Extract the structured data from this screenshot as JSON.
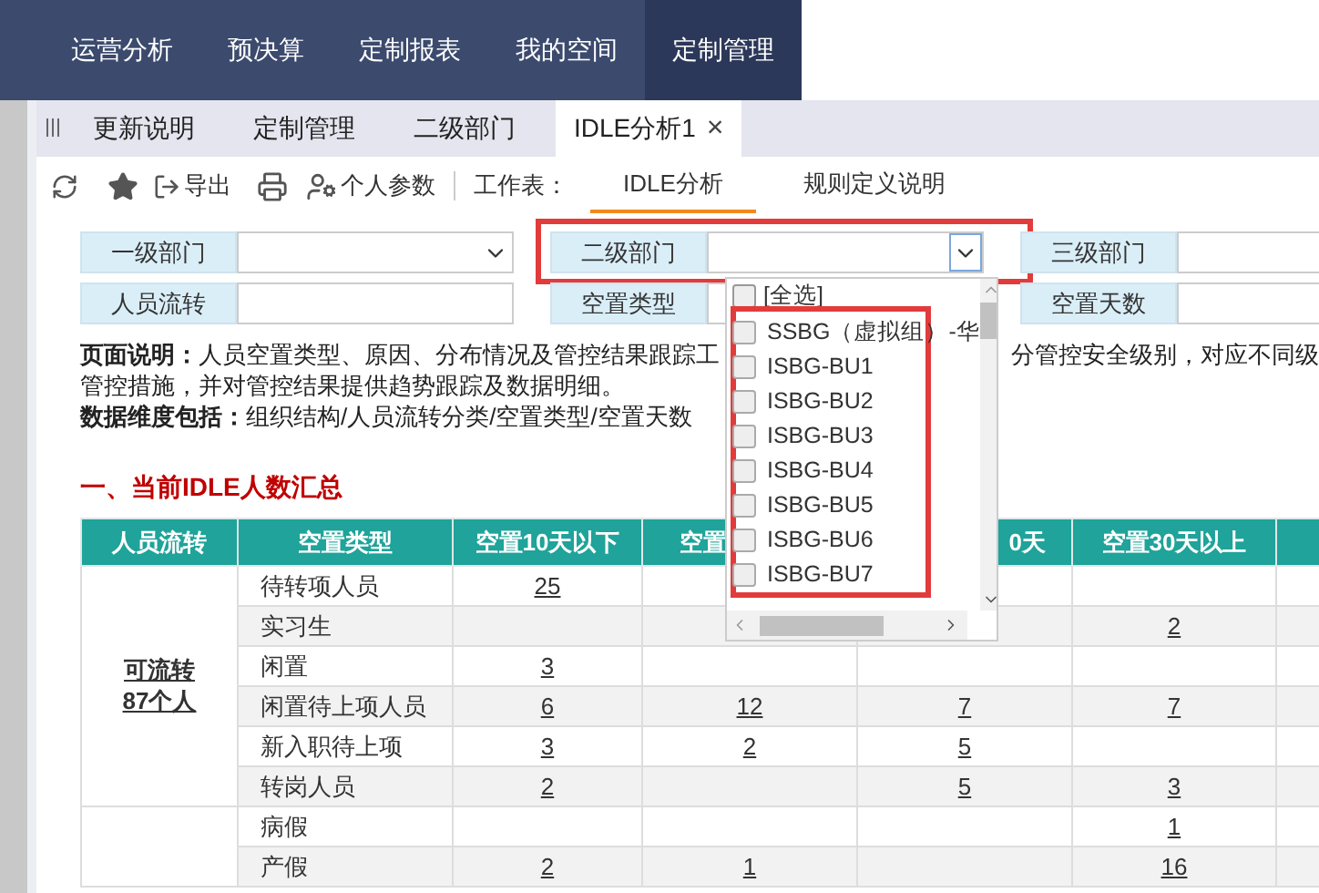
{
  "nav": {
    "items": [
      {
        "label": "运营分析",
        "selected": false
      },
      {
        "label": "预决算",
        "selected": false
      },
      {
        "label": "定制报表",
        "selected": false
      },
      {
        "label": "我的空间",
        "selected": false
      },
      {
        "label": "定制管理",
        "selected": true
      }
    ]
  },
  "tabs": [
    {
      "label": "更新说明",
      "selected": false
    },
    {
      "label": "定制管理",
      "selected": false
    },
    {
      "label": "二级部门",
      "selected": false
    },
    {
      "label": "IDLE分析1",
      "selected": true,
      "close": "×"
    }
  ],
  "toolbar": {
    "export": "导出",
    "personal": "个人参数",
    "sheet_label": "工作表：",
    "sheets": [
      {
        "label": "IDLE分析",
        "selected": true
      },
      {
        "label": "规则定义说明",
        "selected": false
      }
    ]
  },
  "filters": [
    {
      "label": "一级部门",
      "kind": "select"
    },
    {
      "label": "二级部门",
      "kind": "select",
      "focused": true,
      "highlighted": true
    },
    {
      "label": "三级部门",
      "kind": "field"
    },
    {
      "label": "人员流转",
      "kind": "field"
    },
    {
      "label": "空置类型",
      "kind": "field"
    },
    {
      "label": "空置天数",
      "kind": "field"
    }
  ],
  "dropdown": {
    "select_all": {
      "label": "[全选]",
      "checked": false
    },
    "options_highlighted": true,
    "options": [
      {
        "label": "SSBG（虚拟组）-华",
        "checked": false
      },
      {
        "label": "ISBG-BU1",
        "checked": false
      },
      {
        "label": "ISBG-BU2",
        "checked": false
      },
      {
        "label": "ISBG-BU3",
        "checked": false
      },
      {
        "label": "ISBG-BU4",
        "checked": false
      },
      {
        "label": "ISBG-BU5",
        "checked": false
      },
      {
        "label": "ISBG-BU6",
        "checked": false
      },
      {
        "label": "ISBG-BU7",
        "checked": false
      }
    ]
  },
  "description": [
    {
      "kind": "split",
      "left": "**页面说明：**人员空置类型、原因、分布情况及管控结果跟踪工",
      "right": "分管控安全级别，对应不同级"
    },
    {
      "kind": "plain",
      "text": "管控措施，并对管控结果提供趋势跟踪及数据明细。"
    },
    {
      "kind": "plain",
      "text": "**数据维度包括：**组织结构/人员流转分类/空置类型/空置天数"
    }
  ],
  "section_title": "一、当前IDLE人数汇总",
  "table": {
    "columns": [
      {
        "label": "人员流转"
      },
      {
        "label": "空置类型"
      },
      {
        "label": "空置10天以下"
      },
      {
        "label": "空置"
      },
      {
        "label": "0天"
      },
      {
        "label": "空置30天以上"
      }
    ],
    "groups": [
      {
        "label": "可流转",
        "sublabel": "87个人",
        "rows": [
          {
            "type": "待转项人员",
            "under_10": "25"
          },
          {
            "type": "实习生",
            "over_30": "2"
          },
          {
            "type": "闲置",
            "under_10": "3"
          },
          {
            "type": "闲置待上项人员",
            "under_10": "6",
            "column_4": "12",
            "column_5": "7",
            "over_30": "7"
          },
          {
            "type": "新入职待上项",
            "under_10": "3",
            "column_4": "2",
            "column_5": "5"
          },
          {
            "type": "转岗人员",
            "under_10": "2",
            "column_5": "5",
            "over_30": "3"
          }
        ]
      },
      {
        "rows": [
          {
            "type": "病假",
            "over_30": "1"
          },
          {
            "type": "产假",
            "under_10": "2",
            "column_4": "1",
            "over_30": "16"
          }
        ]
      }
    ]
  }
}
